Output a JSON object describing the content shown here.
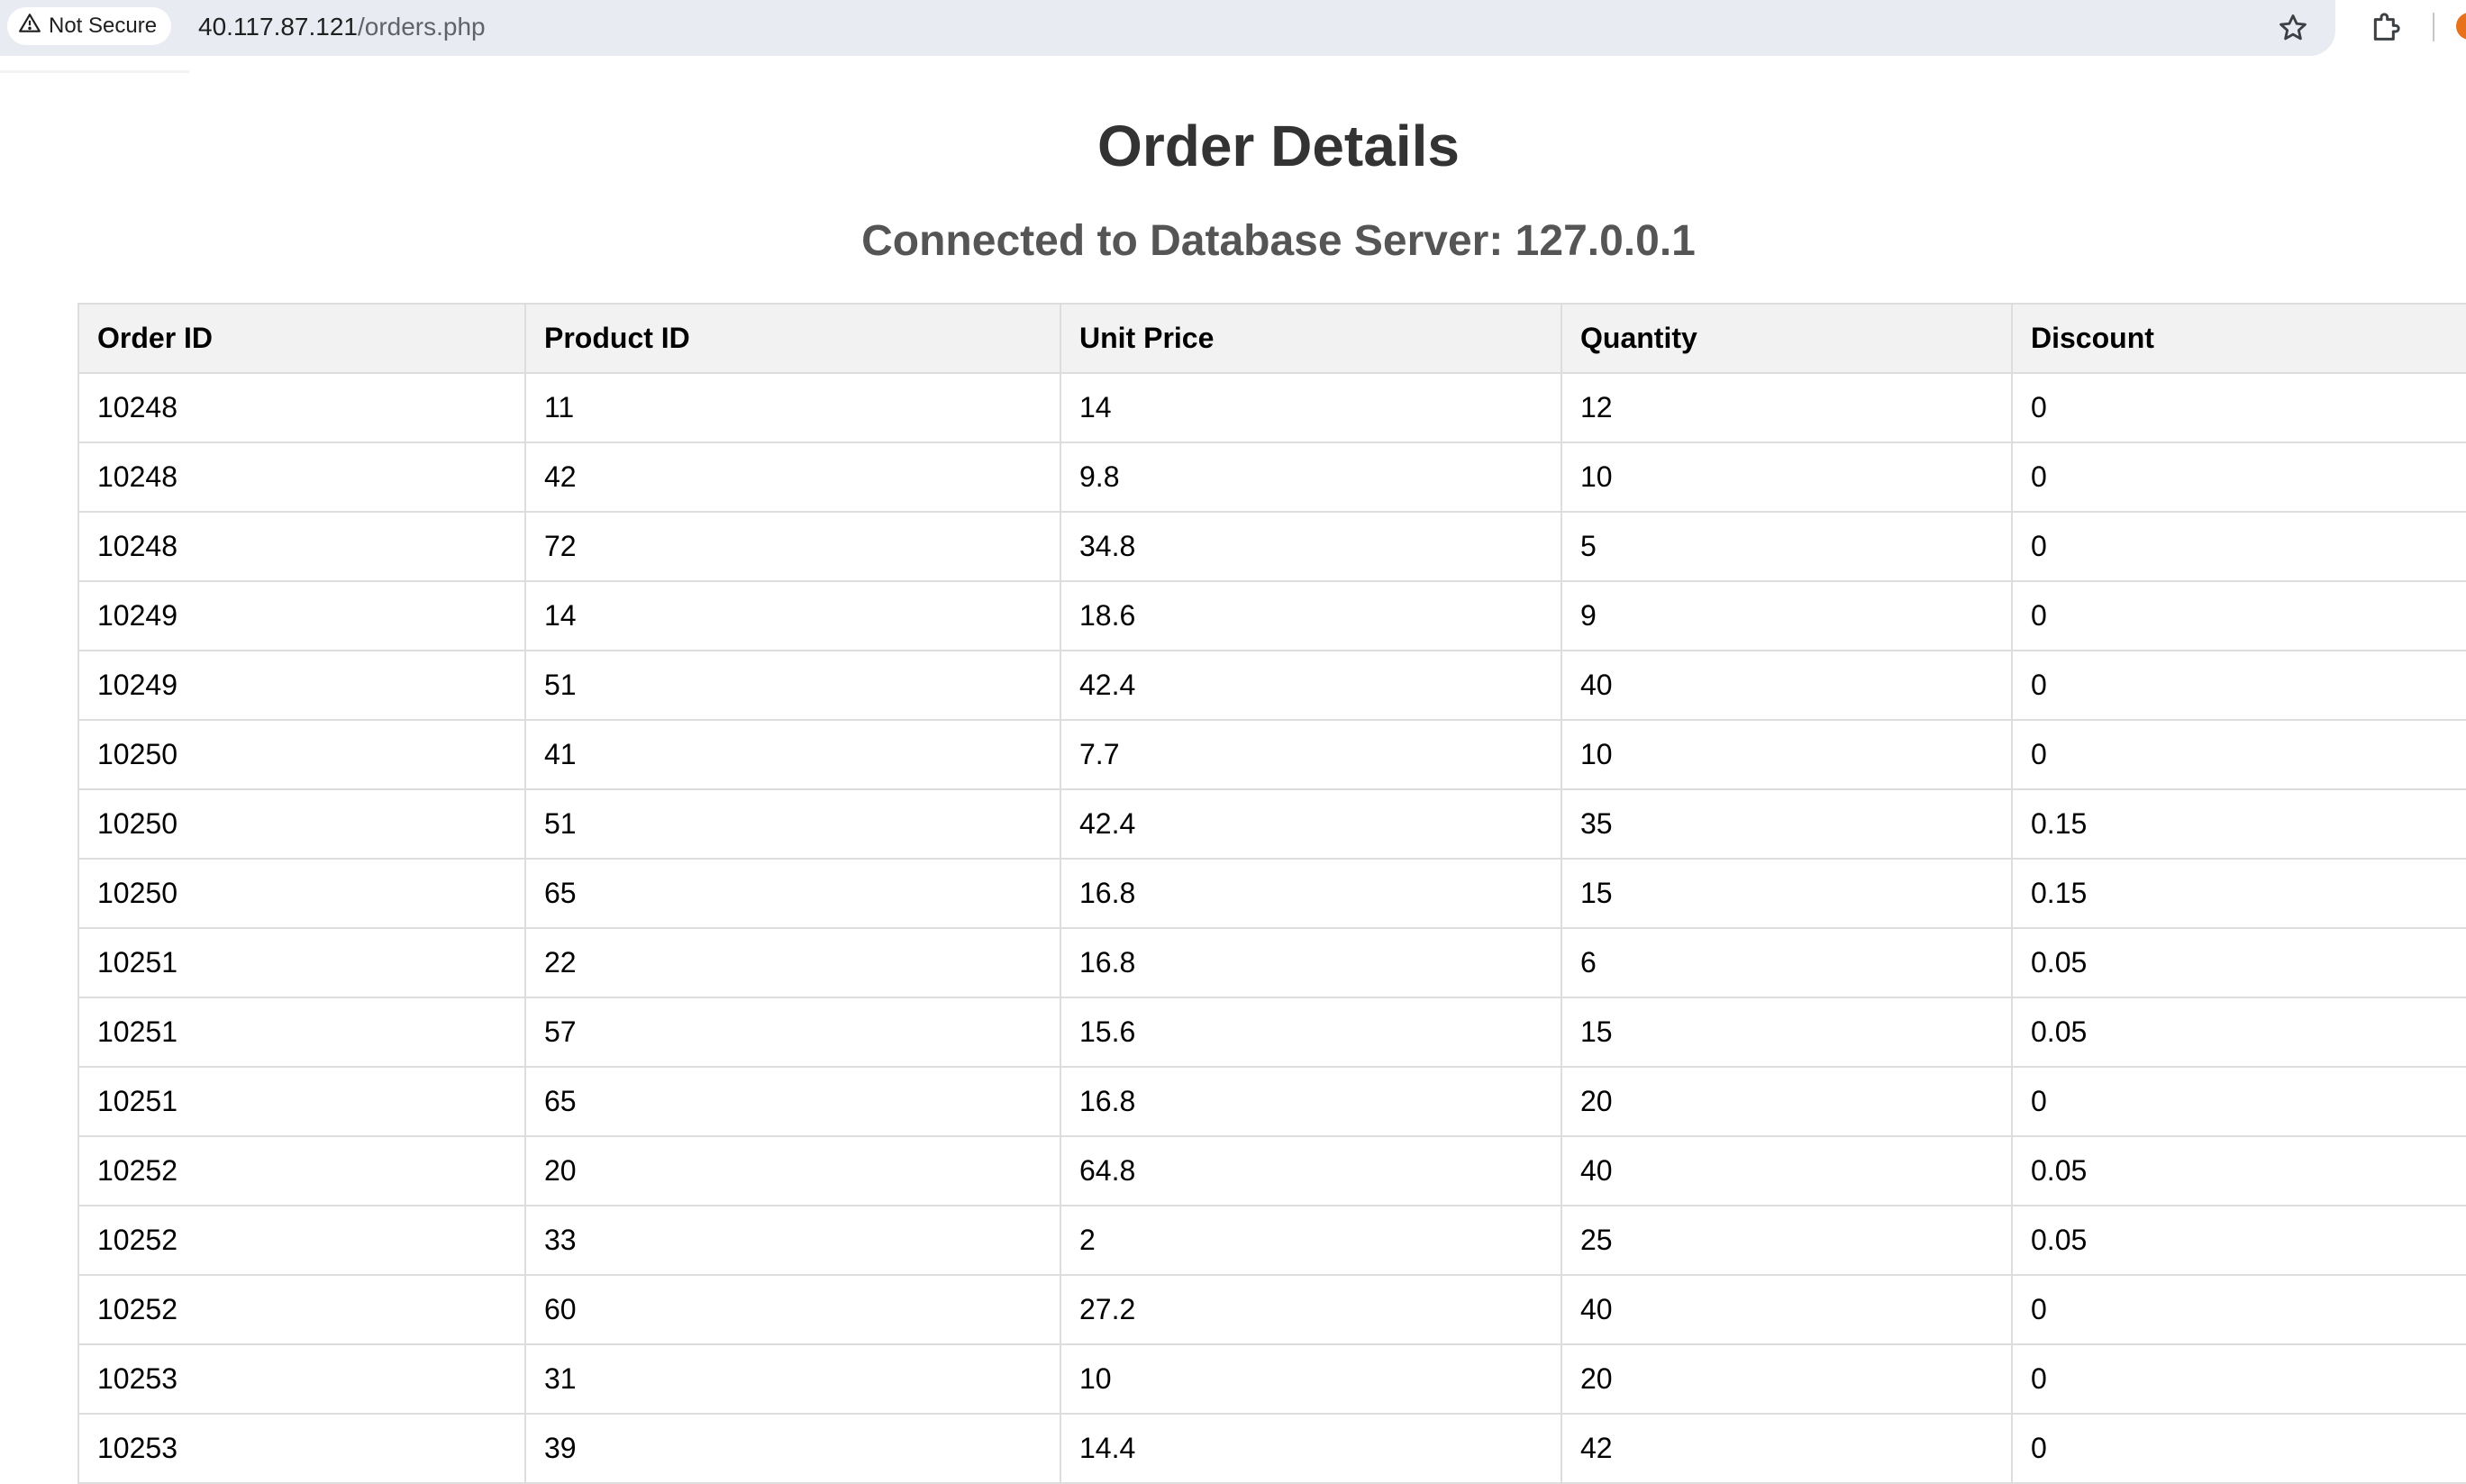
{
  "browser": {
    "security_label": "Not Secure",
    "url_host": "40.117.87.121",
    "url_path": "/orders.php",
    "icons": {
      "security": "warning-triangle-icon",
      "bookmark": "star-icon",
      "extensions": "puzzle-piece-icon"
    }
  },
  "page": {
    "title": "Order Details",
    "subtitle": "Connected to Database Server: 127.0.0.1"
  },
  "table": {
    "headers": [
      "Order ID",
      "Product ID",
      "Unit Price",
      "Quantity",
      "Discount"
    ],
    "rows": [
      [
        "10248",
        "11",
        "14",
        "12",
        "0"
      ],
      [
        "10248",
        "42",
        "9.8",
        "10",
        "0"
      ],
      [
        "10248",
        "72",
        "34.8",
        "5",
        "0"
      ],
      [
        "10249",
        "14",
        "18.6",
        "9",
        "0"
      ],
      [
        "10249",
        "51",
        "42.4",
        "40",
        "0"
      ],
      [
        "10250",
        "41",
        "7.7",
        "10",
        "0"
      ],
      [
        "10250",
        "51",
        "42.4",
        "35",
        "0.15"
      ],
      [
        "10250",
        "65",
        "16.8",
        "15",
        "0.15"
      ],
      [
        "10251",
        "22",
        "16.8",
        "6",
        "0.05"
      ],
      [
        "10251",
        "57",
        "15.6",
        "15",
        "0.05"
      ],
      [
        "10251",
        "65",
        "16.8",
        "20",
        "0"
      ],
      [
        "10252",
        "20",
        "64.8",
        "40",
        "0.05"
      ],
      [
        "10252",
        "33",
        "2",
        "25",
        "0.05"
      ],
      [
        "10252",
        "60",
        "27.2",
        "40",
        "0"
      ],
      [
        "10253",
        "31",
        "10",
        "20",
        "0"
      ],
      [
        "10253",
        "39",
        "14.4",
        "42",
        "0"
      ]
    ]
  }
}
